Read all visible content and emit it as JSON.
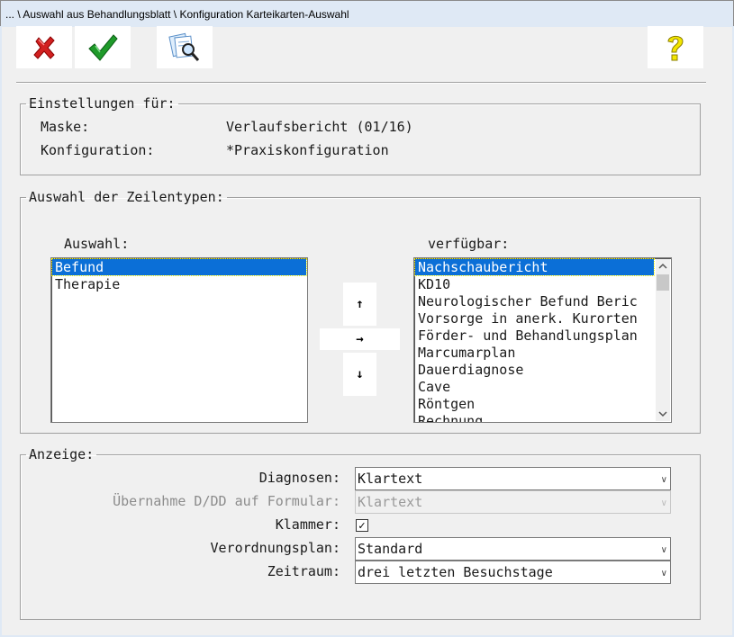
{
  "window": {
    "title": "... \\ Auswahl aus Behandlungsblatt \\ Konfiguration Karteikarten-Auswahl"
  },
  "toolbar": {
    "cancel_icon": "close-icon",
    "ok_icon": "check-icon",
    "preview_icon": "search-document-icon",
    "help_icon": "question-mark-icon"
  },
  "settings": {
    "legend": "Einstellungen für:",
    "mask_label": "Maske:",
    "mask_value": "Verlaufsbericht (01/16)",
    "config_label": "Konfiguration:",
    "config_value": "*Praxiskonfiguration"
  },
  "line_types": {
    "legend": "Auswahl der Zeilentypen:",
    "selection_label": "Auswahl:",
    "available_label": "verfügbar:",
    "selected_items": [
      "Befund",
      "Therapie"
    ],
    "available_items": [
      "Nachschaubericht",
      "KD10",
      "Neurologischer Befund Beric",
      "Vorsorge in anerk. Kurorten",
      "Förder- und Behandlungsplan",
      "Marcumarplan",
      "Dauerdiagnose",
      "Cave",
      "Röntgen",
      "Rechnung"
    ],
    "buttons": {
      "up": "↑",
      "right": "→",
      "down": "↓"
    }
  },
  "display": {
    "legend": "Anzeige:",
    "diagnoses_label": "Diagnosen:",
    "diagnoses_value": "Klartext",
    "transfer_label": "Übernahme D/DD auf Formular:",
    "transfer_value": "Klartext",
    "brackets_label": "Klammer:",
    "brackets_checked": "✓",
    "plan_label": "Verordnungsplan:",
    "plan_value": "Standard",
    "period_label": "Zeitraum:",
    "period_value": "drei letzten Besuchstage"
  }
}
